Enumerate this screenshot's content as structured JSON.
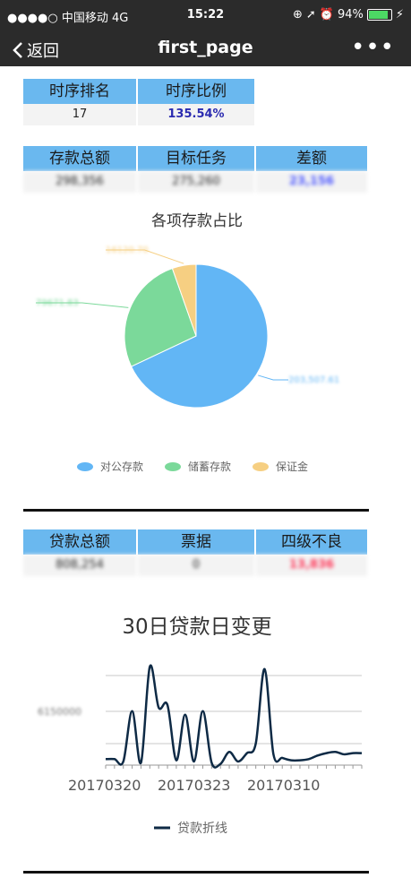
{
  "status": {
    "carrier": "●●●●○ 中国移动  4G",
    "time": "15:22",
    "battery_text": "94%",
    "battery_level": 0.94
  },
  "nav": {
    "back_label": "返回",
    "title": "first_page",
    "more": "•••"
  },
  "rank": {
    "headers": [
      "时序排名",
      "时序比例"
    ],
    "values": [
      "17",
      "135.54%"
    ],
    "ratio_color": "#2b2bb0"
  },
  "deposit_summary": {
    "headers": [
      "存款总额",
      "目标任务",
      "差额"
    ],
    "values": [
      "298,356",
      "275,260",
      "23,156"
    ],
    "diff_color": "#4a55ff"
  },
  "pie": {
    "title": "各项存款占比",
    "slices": [
      {
        "name": "对公存款",
        "label": "203,507.61",
        "value": 203507.61,
        "color": "#62b6f5"
      },
      {
        "name": "储蓄存款",
        "label": "79671.83",
        "value": 79671.83,
        "color": "#7bd99a"
      },
      {
        "name": "保证金",
        "label": "16120.70",
        "value": 16120.7,
        "color": "#f6cf82"
      }
    ]
  },
  "loan_summary": {
    "headers": [
      "贷款总额",
      "票据",
      "四级不良"
    ],
    "values": [
      "808,254",
      "0",
      "13,836"
    ],
    "bad_color": "#ff3355"
  },
  "line": {
    "title": "30日贷款日变更",
    "ytick_label": "6150000",
    "xtick_labels": [
      "20170320",
      "20170323",
      "20170310"
    ],
    "legend": "贷款折线",
    "color": "#0e2a45"
  },
  "chart_data": {
    "type": "line",
    "title": "30日贷款日变更",
    "series": [
      {
        "name": "贷款折线",
        "values": [
          5,
          5,
          3,
          45,
          2,
          82,
          48,
          50,
          4,
          42,
          3,
          45,
          2,
          1,
          11,
          3,
          10,
          18,
          80,
          9,
          6,
          4,
          4,
          5,
          8,
          10,
          11,
          9,
          10,
          10
        ]
      }
    ],
    "ylim": [
      0,
      100
    ]
  }
}
